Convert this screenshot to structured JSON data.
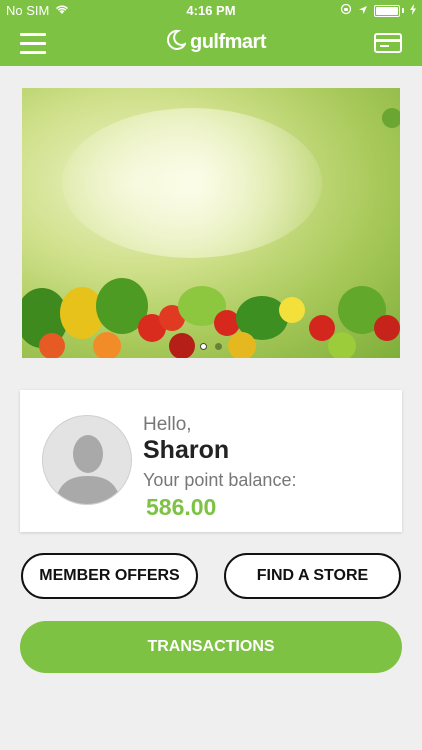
{
  "status_bar": {
    "carrier": "No SIM",
    "time": "4:16 PM",
    "icons": [
      "wifi-icon",
      "location-icon",
      "orientation-lock-icon",
      "battery-icon",
      "charging-icon"
    ]
  },
  "nav": {
    "logo_text": "gulfmart",
    "left_icon": "menu-icon",
    "right_icon": "credit-card-icon"
  },
  "banner": {
    "image_description": "fresh fruits and vegetables",
    "slide_count": 2,
    "active_slide": 1
  },
  "profile": {
    "greeting": "Hello,",
    "name": "Sharon",
    "points_label": "Your point balance:",
    "points_value": "586.00"
  },
  "buttons": {
    "member_offers": "MEMBER OFFERS",
    "find_store": "FIND A STORE",
    "transactions": "TRANSACTIONS"
  },
  "colors": {
    "brand_green": "#7dc243",
    "background": "#efefef"
  }
}
